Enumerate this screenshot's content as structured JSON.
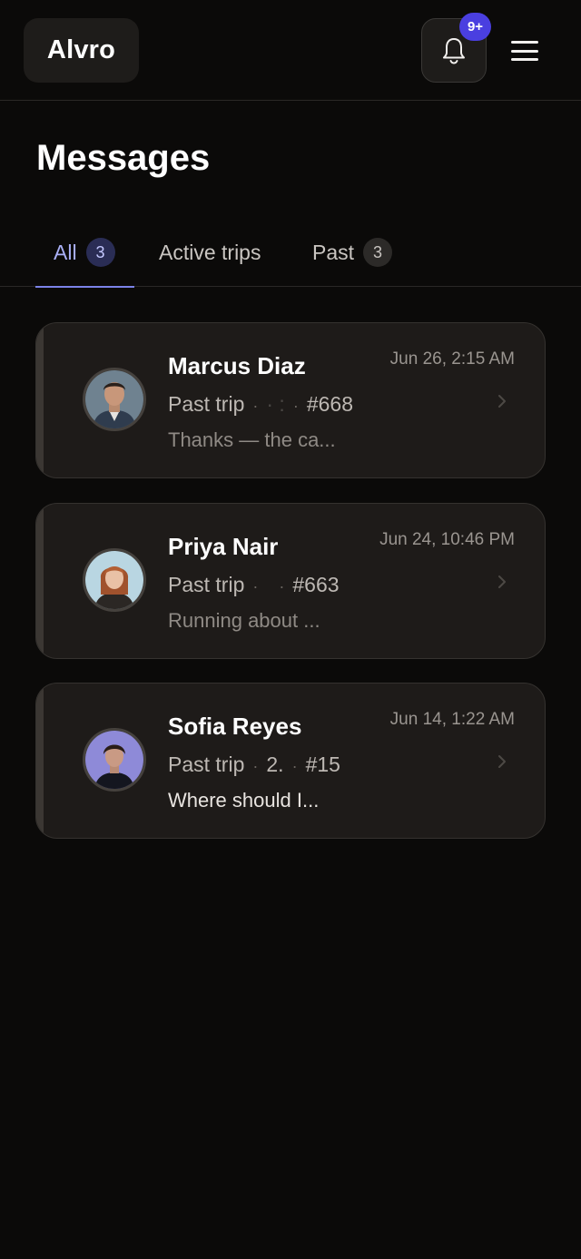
{
  "app": {
    "logo": "Alvro"
  },
  "header": {
    "notification_badge": "9+"
  },
  "page": {
    "title": "Messages"
  },
  "tabs": [
    {
      "label": "All",
      "count": "3"
    },
    {
      "label": "Active trips",
      "count": ""
    },
    {
      "label": "Past",
      "count": "3"
    }
  ],
  "conversations": [
    {
      "name": "Marcus Diaz",
      "time": "Jun 26, 2:15 AM",
      "trip_status": "Past trip",
      "trip_detail": "· :",
      "trip_id": "#668",
      "preview": "Thanks — the ca..."
    },
    {
      "name": "Priya Nair",
      "time": "Jun 24, 10:46 PM",
      "trip_status": "Past trip",
      "trip_detail": "",
      "trip_id": "#663",
      "preview": "Running about ..."
    },
    {
      "name": "Sofia Reyes",
      "time": "Jun 14, 1:22 AM",
      "trip_status": "Past trip",
      "trip_detail": "2.",
      "trip_id": "#15",
      "preview": "Where should I..."
    }
  ],
  "colors": {
    "background": "#0b0a09",
    "card": "#1e1b19",
    "accent": "#7a82e8",
    "badge": "#4a3fe0"
  },
  "icons": [
    "bell-icon",
    "menu-icon",
    "chevron-right-icon"
  ]
}
